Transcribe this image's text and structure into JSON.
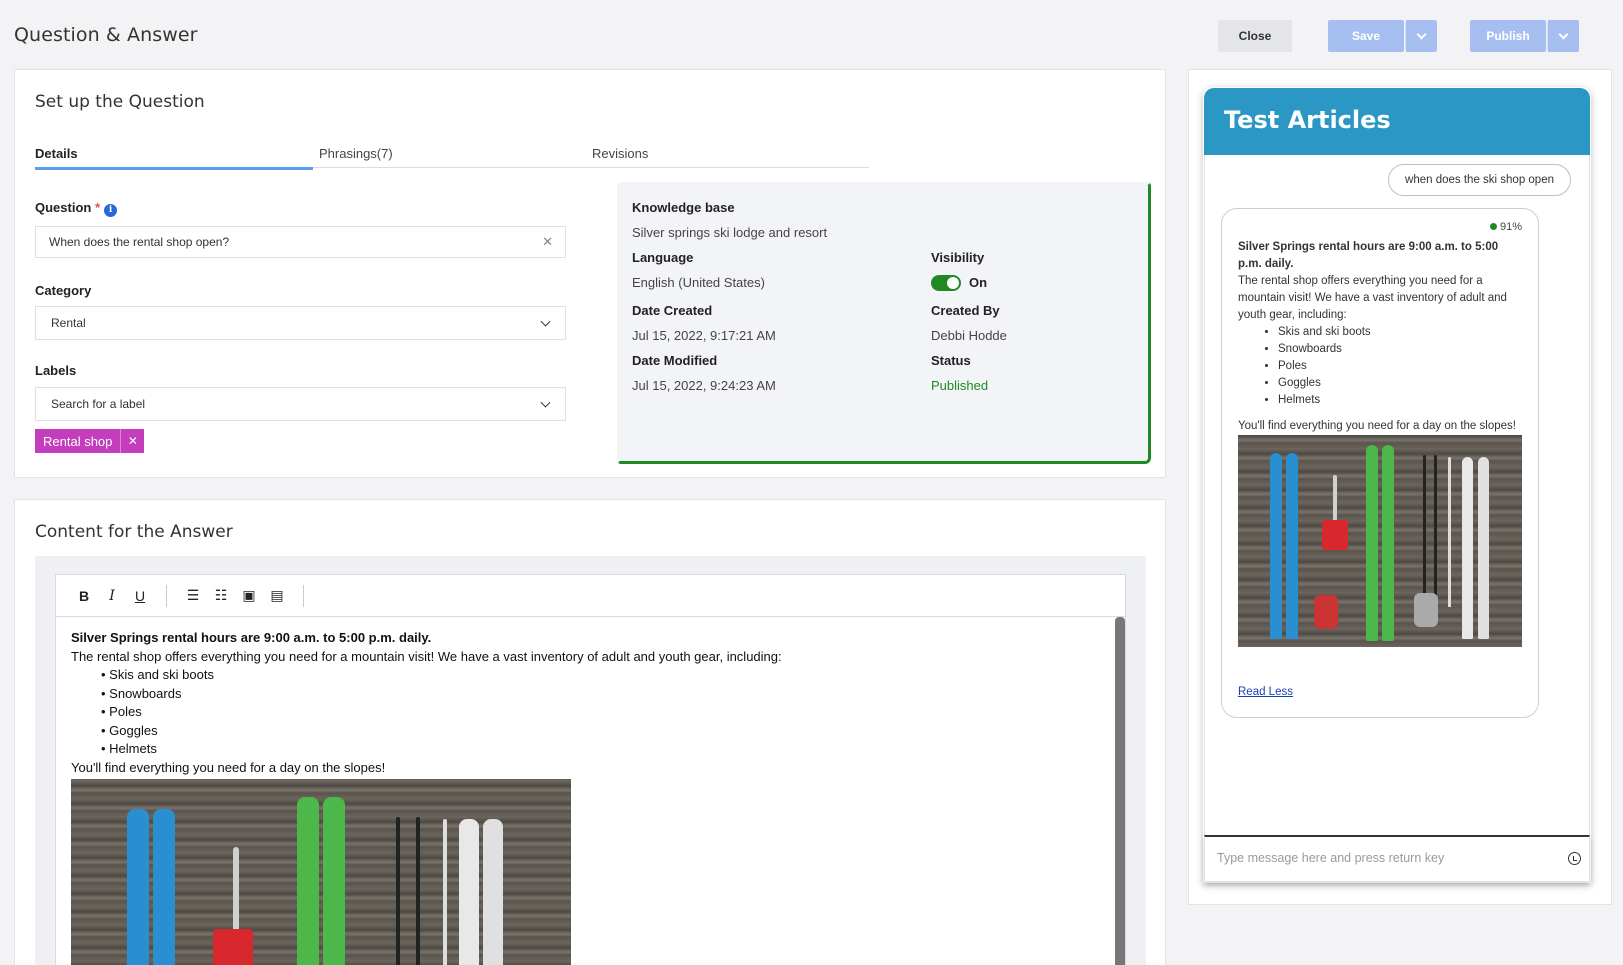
{
  "page": {
    "title": "Question & Answer"
  },
  "actions": {
    "close": "Close",
    "save": "Save",
    "publish": "Publish"
  },
  "setup": {
    "title": "Set up the Question",
    "tabs": [
      "Details",
      "Phrasings(7)",
      "Revisions"
    ],
    "question_label": "Question",
    "question_required": "*",
    "question_value": "When does the rental shop open?",
    "category_label": "Category",
    "category_value": "Rental",
    "labels_label": "Labels",
    "labels_placeholder": "Search for a label",
    "chip": "Rental shop"
  },
  "kb": {
    "kb_label": "Knowledge base",
    "kb_value": "Silver springs ski lodge and resort",
    "language_label": "Language",
    "language_value": "English (United States)",
    "visibility_label": "Visibility",
    "visibility_value": "On",
    "created_label": "Date Created",
    "created_value": "Jul 15, 2022, 9:17:21 AM",
    "created_by_label": "Created By",
    "created_by_value": "Debbi Hodde",
    "modified_label": "Date Modified",
    "modified_value": "Jul 15, 2022, 9:24:23 AM",
    "status_label": "Status",
    "status_value": "Published",
    "status_color": "#1f8a24"
  },
  "answer": {
    "title": "Content for the Answer",
    "toolbar": [
      "B",
      "I",
      "U",
      "bulleted-list",
      "numbered-list",
      "image",
      "video"
    ],
    "heading": "Silver Springs rental hours are 9:00 a.m. to 5:00 p.m. daily.",
    "intro": "The rental shop offers everything you need for a mountain visit! We have a vast inventory of adult and youth gear, including:",
    "items": [
      "Skis and ski boots",
      "Snowboards",
      "Poles",
      "Goggles",
      "Helmets"
    ],
    "outro": "You'll find everything you need for a day on the slopes!"
  },
  "chat": {
    "title": "Test Articles",
    "user_message": "when does the ski shop open",
    "score": "91%",
    "heading": "Silver Springs rental hours are 9:00 a.m. to 5:00 p.m. daily.",
    "intro": "The rental shop offers everything you need for a mountain visit! We have a vast inventory of adult and youth gear, including:",
    "items": [
      "Skis and ski boots",
      "Snowboards",
      "Poles",
      "Goggles",
      "Helmets"
    ],
    "outro": "You'll find everything you need for a day on the slopes!",
    "read_less": "Read Less",
    "input_placeholder": "Type message here and press return key",
    "header_color": "#2b97c4"
  }
}
